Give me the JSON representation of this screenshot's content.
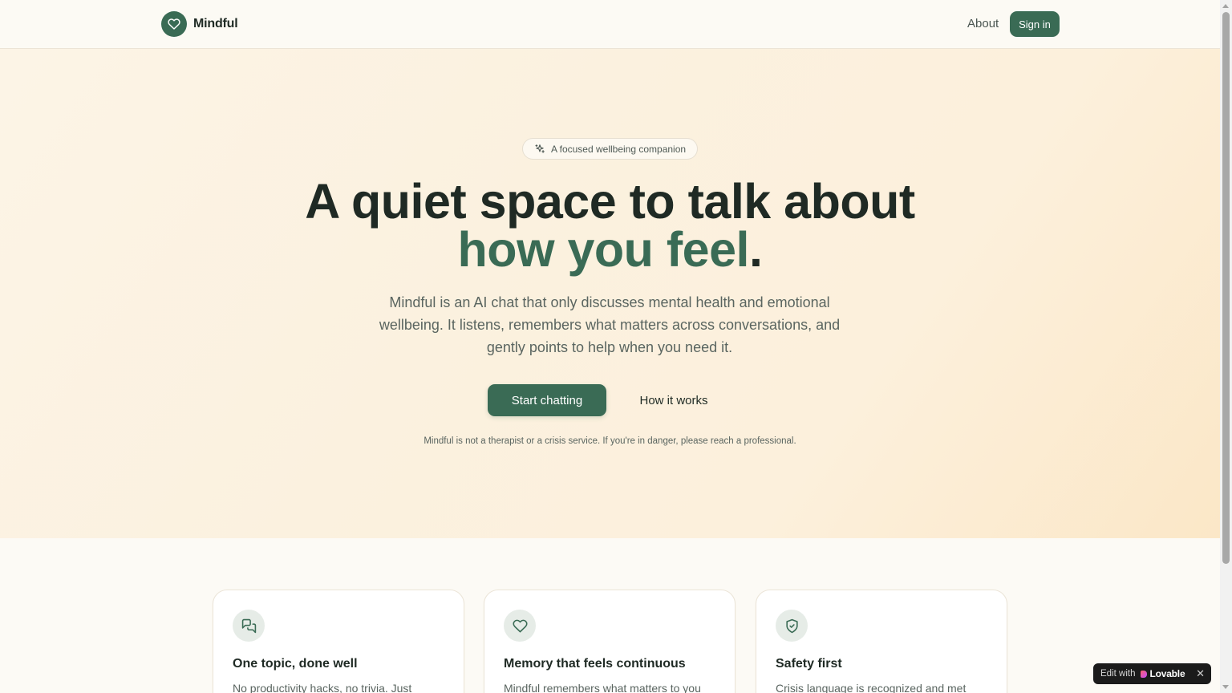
{
  "header": {
    "brand_name": "Mindful",
    "brand_icon": "heart-icon",
    "nav_about": "About",
    "signin_label": "Sign in"
  },
  "hero": {
    "pill_icon": "sparkles-icon",
    "pill_text": "A focused wellbeing companion",
    "headline_line1": "A quiet space to talk about",
    "headline_accent": "how you feel",
    "headline_period": ".",
    "lede": "Mindful is an AI chat that only discusses mental health and emotional wellbeing. It listens, remembers what matters across conversations, and gently points to help when you need it.",
    "cta_primary": "Start chatting",
    "cta_secondary": "How it works",
    "disclaimer": "Mindful is not a therapist or a crisis service. If you're in danger, please reach a professional."
  },
  "features": [
    {
      "icon": "chat-bubbles-icon",
      "title": "One topic, done well",
      "body": "No productivity hacks, no trivia. Just"
    },
    {
      "icon": "heart-icon",
      "title": "Memory that feels continuous",
      "body": "Mindful remembers what matters to you"
    },
    {
      "icon": "shield-check-icon",
      "title": "Safety first",
      "body": "Crisis language is recognized and met"
    }
  ],
  "badge": {
    "edit_label": "Edit with",
    "brand": "Lovable",
    "close": "✕"
  },
  "colors": {
    "accent": "#3a6b55",
    "background": "#fcfaf5",
    "hero_gradient_end": "#fbe7c7",
    "text": "#1f2a24"
  }
}
